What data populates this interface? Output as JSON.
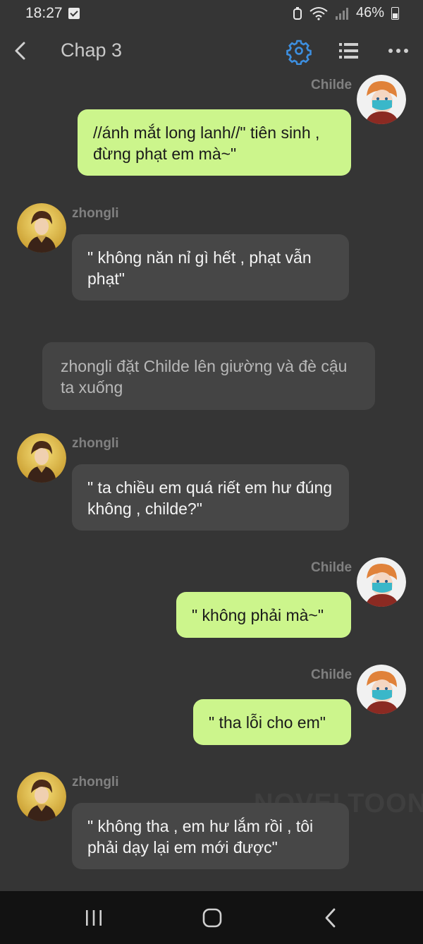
{
  "status": {
    "time": "18:27",
    "battery": "46%"
  },
  "header": {
    "title": "Chap 3"
  },
  "messages": [
    {
      "sender": "Childe",
      "text": "//ánh mắt long lanh//\" tiên sinh , đừng phạt em mà~\""
    },
    {
      "sender": "zhongli",
      "text": "\" không năn nỉ gì hết , phạt vẫn phạt\""
    },
    {
      "narration": "zhongli đặt Childe lên giường và đè cậu ta xuống"
    },
    {
      "sender": "zhongli",
      "text": "\" ta chiều em quá riết em hư đúng không , childe?\""
    },
    {
      "sender": "Childe",
      "text": "\" không phải mà~\""
    },
    {
      "sender": "Childe",
      "text": "\" tha lỗi cho em\""
    },
    {
      "sender": "zhongli",
      "text": "\" không tha , em hư lắm rồi , tôi phải dạy lại em mới được\""
    }
  ],
  "watermark": "NOVELTOON",
  "colors": {
    "background": "#353535",
    "accent": "#3d8fe0",
    "bubble_me": "#ccf58c",
    "bubble_them": "#474747"
  },
  "icons": [
    "back-arrow-icon",
    "gear-icon",
    "list-icon",
    "more-icon",
    "recents-icon",
    "home-icon",
    "nav-back-icon"
  ]
}
